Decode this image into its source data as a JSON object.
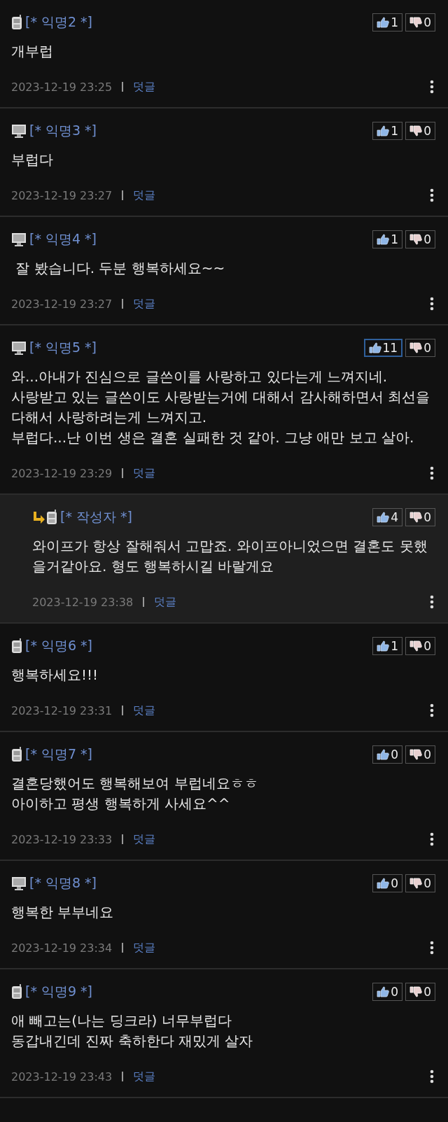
{
  "comments": [
    {
      "kind": "phone",
      "author": "[* 익명2 *]",
      "likes": "1",
      "dislikes": "0",
      "highlighted": false,
      "body": "개부럽",
      "time": "2023-12-19 23:25",
      "reply_link": "덧글"
    },
    {
      "kind": "pc",
      "author": "[* 익명3 *]",
      "likes": "1",
      "dislikes": "0",
      "highlighted": false,
      "body": "부럽다",
      "time": "2023-12-19 23:27",
      "reply_link": "덧글"
    },
    {
      "kind": "pc",
      "author": "[* 익명4 *]",
      "likes": "1",
      "dislikes": "0",
      "highlighted": false,
      "body": " 잘 봤습니다. 두분 행복하세요~~",
      "time": "2023-12-19 23:27",
      "reply_link": "덧글"
    },
    {
      "kind": "pc",
      "author": "[* 익명5 *]",
      "likes": "11",
      "dislikes": "0",
      "highlighted": true,
      "body": "와...아내가 진심으로 글쓴이를 사랑하고 있다는게 느껴지네.\n사랑받고 있는 글쓴이도 사랑받는거에 대해서 감사해하면서 최선을 다해서 사랑하려는게 느껴지고.\n부럽다...난 이번 생은 결혼 실패한 것 같아. 그냥 애만 보고 살아.",
      "time": "2023-12-19 23:29",
      "reply_link": "덧글",
      "replies": [
        {
          "kind": "phone",
          "author": "[* 작성자 *]",
          "likes": "4",
          "dislikes": "0",
          "highlighted": false,
          "body": "와이프가 항상 잘해줘서 고맙죠. 와이프아니었으면 결혼도 못했을거같아요. 형도 행복하시길 바랄게요",
          "time": "2023-12-19 23:38",
          "reply_link": "덧글"
        }
      ]
    },
    {
      "kind": "phone",
      "author": "[* 익명6 *]",
      "likes": "1",
      "dislikes": "0",
      "highlighted": false,
      "body": "행복하세요!!!",
      "time": "2023-12-19 23:31",
      "reply_link": "덧글"
    },
    {
      "kind": "phone",
      "author": "[* 익명7 *]",
      "likes": "0",
      "dislikes": "0",
      "highlighted": false,
      "body": "결혼당했어도 행복해보여 부럽네요ㅎㅎ\n아이하고 평생 행복하게 사세요^^",
      "time": "2023-12-19 23:33",
      "reply_link": "덧글"
    },
    {
      "kind": "pc",
      "author": "[* 익명8 *]",
      "likes": "0",
      "dislikes": "0",
      "highlighted": false,
      "body": "행복한 부부네요",
      "time": "2023-12-19 23:34",
      "reply_link": "덧글"
    },
    {
      "kind": "phone",
      "author": "[* 익명9 *]",
      "likes": "0",
      "dislikes": "0",
      "highlighted": false,
      "body": "애 빼고는(나는 딩크라) 너무부럽다\n동갑내긴데 진짜 축하한다 재밌게 살자",
      "time": "2023-12-19 23:43",
      "reply_link": "덧글"
    }
  ]
}
